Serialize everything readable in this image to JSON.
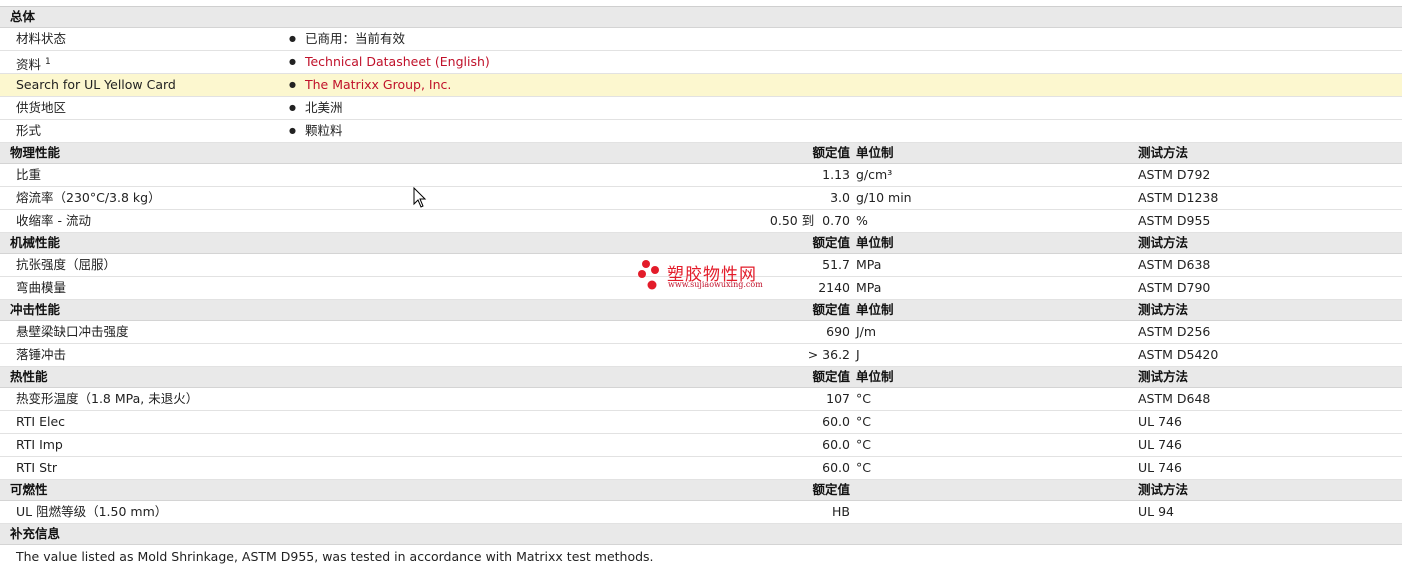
{
  "general": {
    "title": "总体",
    "rows": [
      {
        "label": "材料状态",
        "value": "已商用：当前有效",
        "link": false
      },
      {
        "label": "资料",
        "sup": "1",
        "value": "Technical Datasheet (English)",
        "link": true
      },
      {
        "label": "Search for UL Yellow Card",
        "value": "The Matrixx Group, Inc.",
        "link": true,
        "highlight": true
      },
      {
        "label": "供货地区",
        "value": "北美洲",
        "link": false
      },
      {
        "label": "形式",
        "value": "颗粒料",
        "link": false
      }
    ]
  },
  "physical": {
    "title": "物理性能",
    "col_value": "额定值",
    "col_unit": "单位制",
    "col_method": "测试方法",
    "rows": [
      {
        "label": "比重",
        "value": "1.13",
        "unit": "g/cm³",
        "method": "ASTM D792"
      },
      {
        "label": "熔流率（230°C/3.8 kg）",
        "value": "3.0",
        "unit": "g/10 min",
        "method": "ASTM D1238"
      },
      {
        "label": "收缩率 - 流动",
        "value": "0.50 到  0.70",
        "unit": "%",
        "method": "ASTM D955"
      }
    ]
  },
  "mechanical": {
    "title": "机械性能",
    "col_value": "额定值",
    "col_unit": "单位制",
    "col_method": "测试方法",
    "rows": [
      {
        "label": "抗张强度（屈服）",
        "value": "51.7",
        "unit": "MPa",
        "method": "ASTM D638"
      },
      {
        "label": "弯曲模量",
        "value": "2140",
        "unit": "MPa",
        "method": "ASTM D790"
      }
    ]
  },
  "impact": {
    "title": "冲击性能",
    "col_value": "额定值",
    "col_unit": "单位制",
    "col_method": "测试方法",
    "rows": [
      {
        "label": "悬壁梁缺口冲击强度",
        "value": "690",
        "unit": "J/m",
        "method": "ASTM D256"
      },
      {
        "label": "落锤冲击",
        "value": "> 36.2",
        "unit": "J",
        "method": "ASTM D5420"
      }
    ]
  },
  "thermal": {
    "title": "热性能",
    "col_value": "额定值",
    "col_unit": "单位制",
    "col_method": "测试方法",
    "rows": [
      {
        "label": "热变形温度（1.8 MPa, 未退火）",
        "value": "107",
        "unit": "°C",
        "method": "ASTM D648"
      },
      {
        "label": "RTI Elec",
        "value": "60.0",
        "unit": "°C",
        "method": "UL 746"
      },
      {
        "label": "RTI Imp",
        "value": "60.0",
        "unit": "°C",
        "method": "UL 746"
      },
      {
        "label": "RTI Str",
        "value": "60.0",
        "unit": "°C",
        "method": "UL 746"
      }
    ]
  },
  "flammability": {
    "title": "可燃性",
    "col_value": "额定值",
    "col_method": "测试方法",
    "rows": [
      {
        "label": "UL 阻燃等级（1.50 mm）",
        "value": "HB",
        "unit": "",
        "method": "UL 94"
      }
    ]
  },
  "supplement": {
    "title": "补充信息",
    "note": "The value listed as Mold Shrinkage, ASTM D955, was tested in accordance with Matrixx test methods."
  },
  "watermark": {
    "title": "塑胶物性网",
    "url": "www.sujiaowuxing.com"
  },
  "colors": {
    "link": "#c0112a",
    "section_bg": "#e9e9e9",
    "highlight_bg": "#fcf7cf",
    "watermark": "#e31c2a"
  }
}
